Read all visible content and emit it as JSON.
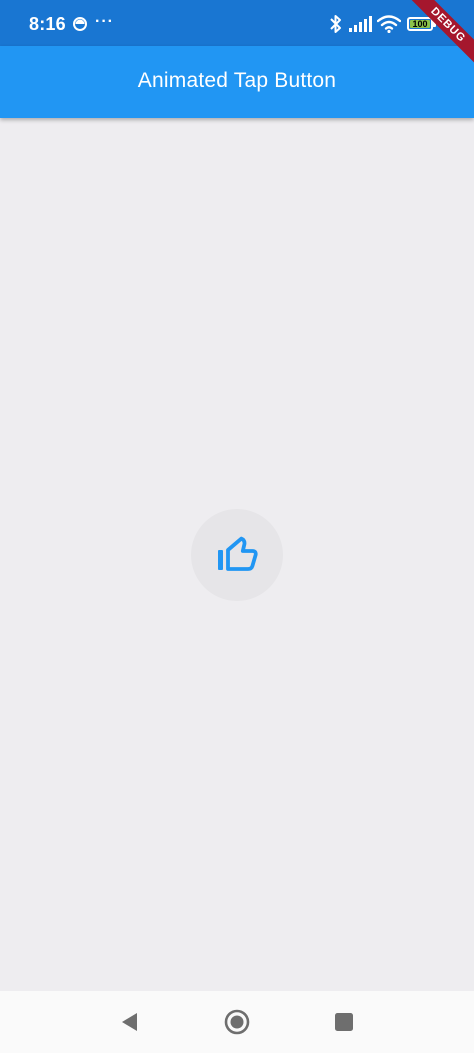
{
  "status_bar": {
    "time": "8:16",
    "more_indicator": "···",
    "battery_level": "100",
    "icons": [
      "notification-icon",
      "bluetooth-icon",
      "signal-icon",
      "wifi-icon",
      "battery-icon"
    ]
  },
  "debug_banner": {
    "label": "DEBUG"
  },
  "app_bar": {
    "title": "Animated Tap Button"
  },
  "main": {
    "button": {
      "icon": "thumb-up-icon"
    }
  },
  "nav_bar": {
    "buttons": [
      "back-icon",
      "home-icon",
      "recents-icon"
    ]
  },
  "colors": {
    "status_bar": "#1976D2",
    "app_bar": "#2196F3",
    "background": "#EEEDF0",
    "button_background": "#E6E5E8",
    "icon_accent": "#2196F3",
    "debug_banner": "#A5172D",
    "battery_fill": "#8BC34A",
    "nav_bar": "#FAFAFA",
    "nav_icons": "#6E6E6E"
  }
}
